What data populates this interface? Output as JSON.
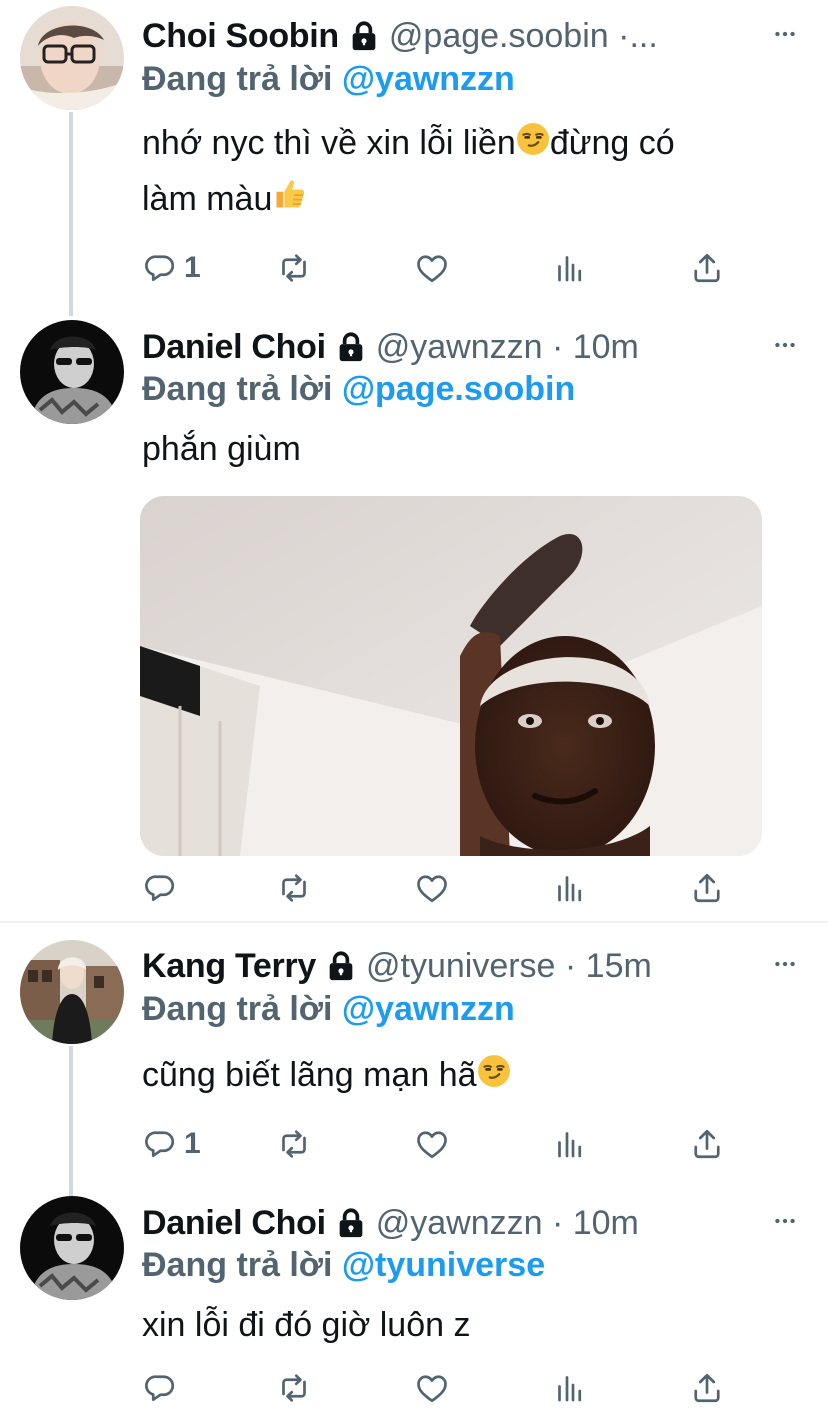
{
  "tweets": [
    {
      "name": "Choi Soobin",
      "handle": "@page.soobin ·...",
      "reply_prefix": "Đang trả lời",
      "reply_to": "@yawnzzn",
      "text_line1": "nhớ nyc thì về xin lỗi liền",
      "text_line1_end": "đừng có",
      "text_line2": "làm màu",
      "reply_count": "1"
    },
    {
      "name": "Daniel Choi",
      "handle": "@yawnzzn · 10m",
      "reply_prefix": "Đang trả lời",
      "reply_to": "@page.soobin",
      "text": "phắn giùm",
      "reply_count": ""
    },
    {
      "name": "Kang Terry",
      "handle": "@tyuniverse · 15m",
      "reply_prefix": "Đang trả lời",
      "reply_to": "@yawnzzn",
      "text": "cũng biết lãng mạn hã",
      "reply_count": "1"
    },
    {
      "name": "Daniel Choi",
      "handle": "@yawnzzn · 10m",
      "reply_prefix": "Đang trả lời",
      "reply_to": "@tyuniverse",
      "text": "xin lỗi đi đó giờ luôn z",
      "reply_count": ""
    }
  ],
  "icons": [
    "reply-icon",
    "retweet-icon",
    "like-icon",
    "views-icon",
    "share-icon",
    "lock-icon",
    "more-icon"
  ],
  "colors": {
    "link": "#1d9bf0",
    "secondary": "#536471",
    "text": "#0f1419",
    "thread": "#cfd9de"
  }
}
